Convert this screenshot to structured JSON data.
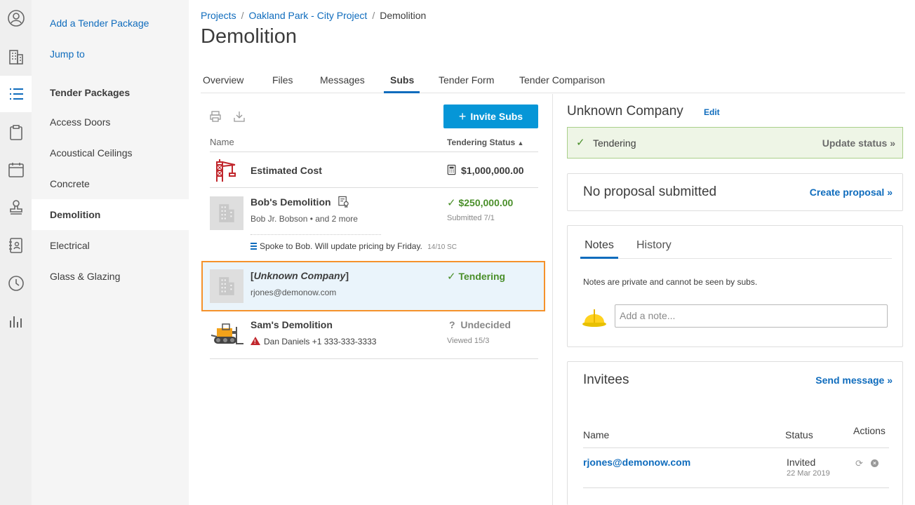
{
  "rail": {
    "icons": [
      "user-icon",
      "building-icon",
      "list-icon",
      "clipboard-icon",
      "calendar-icon",
      "stamp-icon",
      "address-book-icon",
      "clock-icon",
      "chart-icon"
    ]
  },
  "sidebar": {
    "add_link": "Add a Tender Package",
    "jump_link": "Jump to",
    "heading": "Tender Packages",
    "items": [
      "Access Doors",
      "Acoustical Ceilings",
      "Concrete",
      "Demolition",
      "Electrical",
      "Glass & Glazing"
    ],
    "active_item": "Demolition"
  },
  "breadcrumb": {
    "projects": "Projects",
    "project": "Oakland Park - City Project",
    "current": "Demolition",
    "sep": "/"
  },
  "page_title": "Demolition",
  "tabs": [
    "Overview",
    "Files",
    "Messages",
    "Subs",
    "Tender Form",
    "Tender Comparison"
  ],
  "active_tab": "Subs",
  "list": {
    "invite_button": "Invite Subs",
    "col_name": "Name",
    "col_status": "Tendering Status",
    "estimated": {
      "label": "Estimated Cost",
      "value": "$1,000,000.00"
    },
    "rows": [
      {
        "name": "Bob's Demolition",
        "contact": "Bob Jr. Bobson • and 2 more",
        "status": "$250,000.00",
        "status_sub": "Submitted 7/1",
        "note": "Spoke to Bob. Will update pricing by Friday.",
        "note_meta": "14/10 SC"
      },
      {
        "name_prefix": "[",
        "name": "Unknown Company",
        "name_suffix": "]",
        "contact": "rjones@demonow.com",
        "status": "Tendering"
      },
      {
        "name": "Sam's Demolition",
        "contact": "Dan Daniels +1 333-333-3333",
        "status": "Undecided",
        "status_sub": "Viewed 15/3"
      }
    ]
  },
  "detail": {
    "company": "Unknown Company",
    "edit": "Edit",
    "status": "Tendering",
    "update_status": "Update status »",
    "proposal_title": "No proposal submitted",
    "create_proposal": "Create proposal »",
    "notes_tab": "Notes",
    "history_tab": "History",
    "notes_hint": "Notes are private and cannot be seen by subs.",
    "note_placeholder": "Add a note...",
    "invitees_title": "Invitees",
    "send_message": "Send message »",
    "inv_col_name": "Name",
    "inv_col_status": "Status",
    "inv_col_actions": "Actions",
    "invitee": {
      "email": "rjones@demonow.com",
      "status": "Invited",
      "date": "22 Mar 2019"
    }
  },
  "colors": {
    "link": "#0f6cbd",
    "accent": "#0696d7",
    "green": "#4a8f2a",
    "selected_border": "#f5922b"
  }
}
